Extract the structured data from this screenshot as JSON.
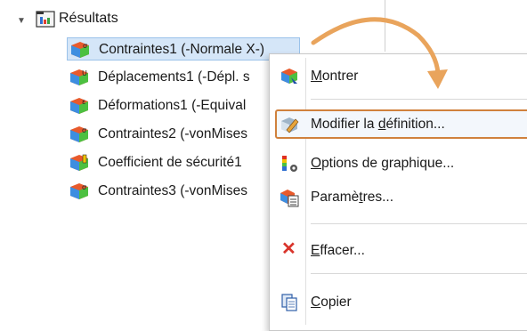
{
  "tree": {
    "root_label": "Résultats",
    "items": [
      {
        "label": "Contraintes1 (-Normale X-)",
        "icon": "stress-result-icon",
        "selected": true
      },
      {
        "label": "Déplacements1 (-Dépl. s",
        "icon": "displacement-result-icon"
      },
      {
        "label": "Déformations1 (-Equival",
        "icon": "strain-result-icon"
      },
      {
        "label": "Contraintes2 (-vonMises",
        "icon": "stress-result-icon"
      },
      {
        "label": "Coefficient de sécurité1",
        "icon": "safety-factor-icon"
      },
      {
        "label": "Contraintes3 (-vonMises",
        "icon": "stress-result-icon"
      }
    ]
  },
  "menu": {
    "show": {
      "prefix": "",
      "mnemonic": "M",
      "rest": "ontrer"
    },
    "edit": {
      "prefix": "Modifier la ",
      "mnemonic": "d",
      "rest": "éfinition..."
    },
    "chart_options": {
      "prefix": "",
      "mnemonic": "O",
      "rest": "ptions de graphique..."
    },
    "settings": {
      "prefix": "Paramè",
      "mnemonic": "t",
      "rest": "res..."
    },
    "delete": {
      "prefix": "",
      "mnemonic": "E",
      "rest": "ffacer..."
    },
    "copy": {
      "prefix": "",
      "mnemonic": "C",
      "rest": "opier"
    }
  },
  "colors": {
    "highlight_border": "#d0813d",
    "selection_bg": "#d5e6f8",
    "delete_red": "#d9342b"
  }
}
